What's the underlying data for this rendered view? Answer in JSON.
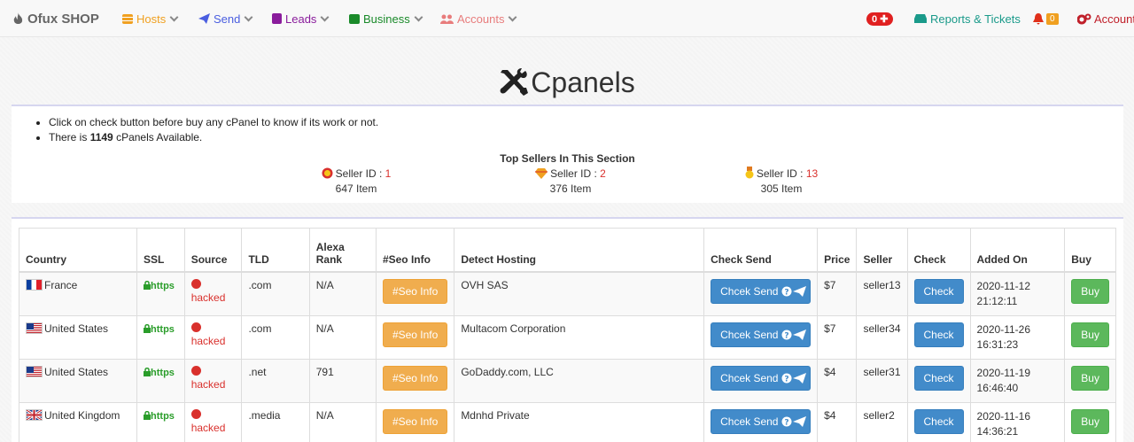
{
  "nav": {
    "brand": "Ofux SHOP",
    "hosts": "Hosts",
    "send": "Send",
    "leads": "Leads",
    "business": "Business",
    "accounts": "Accounts",
    "cart_badge": "0",
    "reports": "Reports & Tickets",
    "notif_count": "0",
    "account": "Account"
  },
  "page": {
    "title": "Cpanels"
  },
  "info": {
    "line1": "Click on check button before buy any cPanel to know if its work or not.",
    "line2_prefix": "There is ",
    "line2_count": "1149",
    "line2_suffix": " cPanels Available.",
    "top_sellers_title": "Top Sellers In This Section",
    "sellers": [
      {
        "label": "Seller ID : ",
        "id": "1",
        "items": "647 Item"
      },
      {
        "label": "Seller ID : ",
        "id": "2",
        "items": "376 Item"
      },
      {
        "label": "Seller ID : ",
        "id": "13",
        "items": "305 Item"
      }
    ]
  },
  "table": {
    "headers": {
      "country": "Country",
      "ssl": "SSL",
      "source": "Source",
      "tld": "TLD",
      "alexa_l1": "Alexa",
      "alexa_l2": "Rank",
      "seo": "#Seo Info",
      "hosting": "Detect Hosting",
      "check_send": "Check Send",
      "price": "Price",
      "seller": "Seller",
      "check": "Check",
      "added": "Added On",
      "buy": "Buy"
    },
    "ssl_label": "https",
    "source_label": "hacked",
    "seo_btn": "#Seo Info",
    "send_btn": "Chcek Send",
    "check_btn": "Check",
    "buy_btn": "Buy",
    "rows": [
      {
        "country": "France",
        "tld": ".com",
        "alexa": "N/A",
        "hosting": "OVH SAS",
        "price": "$7",
        "seller": "seller13",
        "date": "2020-11-12",
        "time": "21:12:11"
      },
      {
        "country": "United States",
        "tld": ".com",
        "alexa": "N/A",
        "hosting": "Multacom Corporation",
        "price": "$7",
        "seller": "seller34",
        "date": "2020-11-26",
        "time": "16:31:23"
      },
      {
        "country": "United States",
        "tld": ".net",
        "alexa": "791",
        "hosting": "GoDaddy.com, LLC",
        "price": "$4",
        "seller": "seller31",
        "date": "2020-11-19",
        "time": "16:46:40"
      },
      {
        "country": "United Kingdom",
        "tld": ".media",
        "alexa": "N/A",
        "hosting": "Mdnhd Private",
        "price": "$4",
        "seller": "seller2",
        "date": "2020-11-16",
        "time": "14:36:21"
      }
    ]
  }
}
